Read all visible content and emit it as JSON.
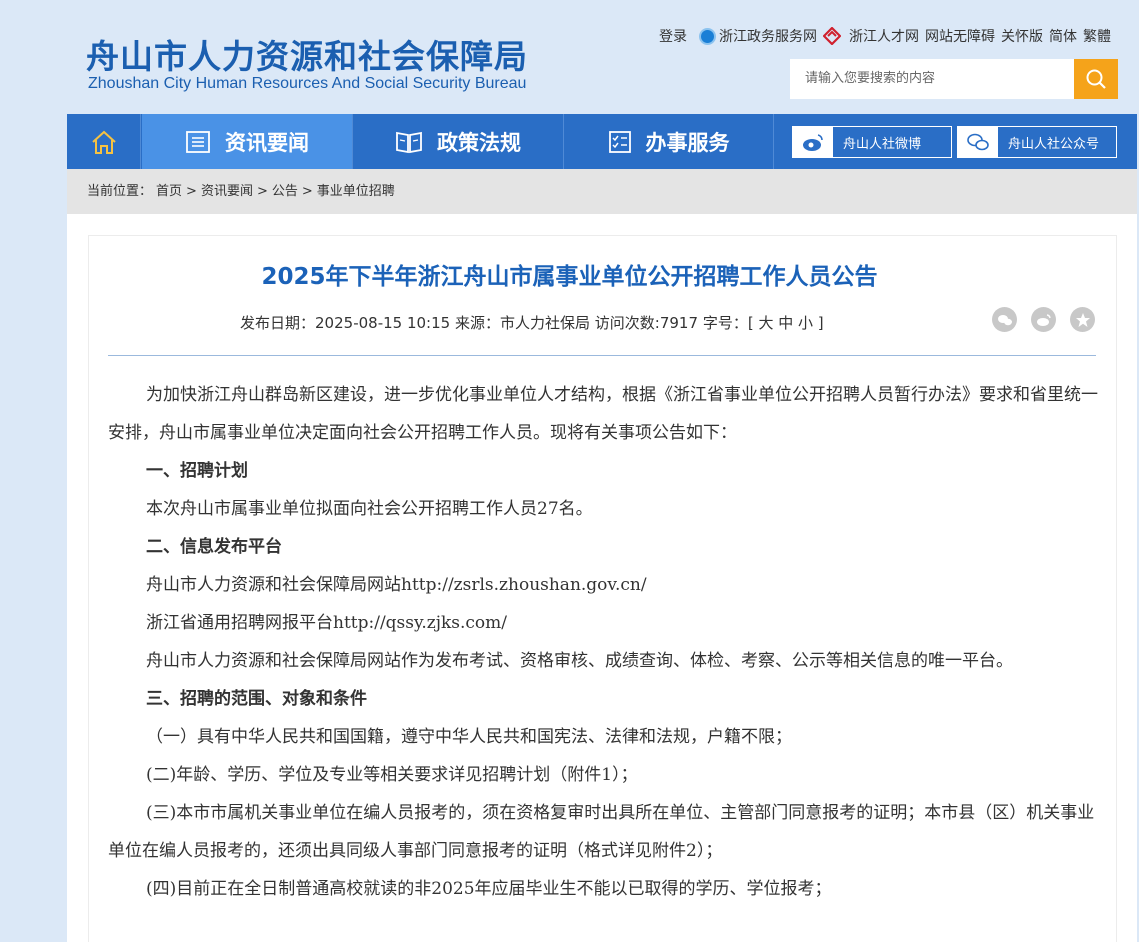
{
  "header": {
    "logo_cn": "舟山市人力资源和社会保障局",
    "logo_en": "Zhoushan City Human Resources And Social Security Bureau",
    "links": {
      "login": "登录",
      "zjzw": "浙江政务服务网",
      "zjrc": "浙江人才网",
      "accessible": "网站无障碍",
      "care": "关怀版",
      "simplified": "简体",
      "traditional": "繁體"
    },
    "search_placeholder": "请输入您要搜索的内容"
  },
  "nav": {
    "items": [
      {
        "label": "资讯要闻",
        "active": true
      },
      {
        "label": "政策法规",
        "active": false
      },
      {
        "label": "办事服务",
        "active": false
      }
    ],
    "weibo": "舟山人社微博",
    "wechat": "舟山人社公众号"
  },
  "breadcrumb": {
    "prefix": "当前位置：",
    "items": [
      "首页",
      "资讯要闻",
      "公告",
      "事业单位招聘"
    ]
  },
  "article": {
    "title": "2025年下半年浙江舟山市属事业单位公开招聘工作人员公告",
    "meta": {
      "date_label": "发布日期：",
      "date": "2025-08-15 10:15",
      "source_label": "来源：",
      "source": "市人力社保局",
      "views_label": "访问次数:",
      "views": "7917",
      "font_label": "字号：",
      "font_sizes": "[ 大 中 小 ]"
    },
    "paragraphs": [
      {
        "text": "为加快浙江舟山群岛新区建设，进一步优化事业单位人才结构，根据《浙江省事业单位公开招聘人员暂行办法》要求和省里统一安排，舟山市属事业单位决定面向社会公开招聘工作人员。现将有关事项公告如下：",
        "heading": false
      },
      {
        "text": "一、招聘计划",
        "heading": true
      },
      {
        "text": "本次舟山市属事业单位拟面向社会公开招聘工作人员27名。",
        "heading": false
      },
      {
        "text": "二、信息发布平台",
        "heading": true
      },
      {
        "text": "舟山市人力资源和社会保障局网站http://zsrls.zhoushan.gov.cn/",
        "heading": false
      },
      {
        "text": "浙江省通用招聘网报平台http://qssy.zjks.com/",
        "heading": false
      },
      {
        "text": "舟山市人力资源和社会保障局网站作为发布考试、资格审核、成绩查询、体检、考察、公示等相关信息的唯一平台。",
        "heading": false
      },
      {
        "text": "三、招聘的范围、对象和条件",
        "heading": true
      },
      {
        "text": "（一）具有中华人民共和国国籍，遵守中华人民共和国宪法、法律和法规，户籍不限；",
        "heading": false
      },
      {
        "text": "(二)年龄、学历、学位及专业等相关要求详见招聘计划（附件1）；",
        "heading": false
      },
      {
        "text": "(三)本市市属机关事业单位在编人员报考的，须在资格复审时出具所在单位、主管部门同意报考的证明；本市县（区）机关事业单位在编人员报考的，还须出具同级人事部门同意报考的证明（格式详见附件2）；",
        "heading": false
      },
      {
        "text": "(四)目前正在全日制普通高校就读的非2025年应届毕业生不能以已取得的学历、学位报考；",
        "heading": false
      }
    ]
  },
  "colors": {
    "brand_blue": "#1b5fb0",
    "nav_blue": "#2a6ec6",
    "nav_active": "#4a92e6",
    "search_orange": "#f5a31a"
  }
}
